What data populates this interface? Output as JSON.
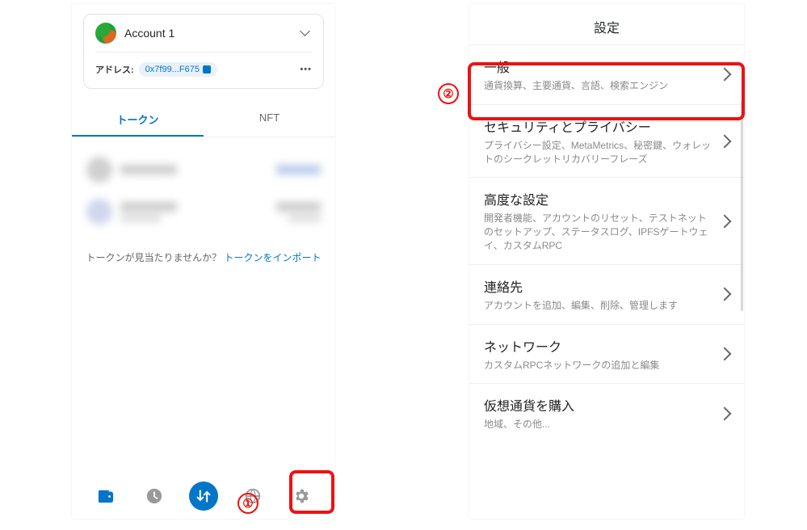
{
  "left": {
    "account_name": "Account 1",
    "address_label": "アドレス:",
    "address_short": "0x7f99...F675",
    "tabs": {
      "tokens": "トークン",
      "nft": "NFT"
    },
    "import_prompt": "トークンが見当たりませんか？ ",
    "import_link": "トークンをインポート"
  },
  "right": {
    "header": "設定",
    "items": [
      {
        "title": "一般",
        "desc": "通貨換算、主要通貨、言語、検索エンジン"
      },
      {
        "title": "セキュリティとプライバシー",
        "desc": "プライバシー設定、MetaMetrics、秘密鍵、ウォレットのシークレットリカバリーフレーズ"
      },
      {
        "title": "高度な設定",
        "desc": "開発者機能、アカウントのリセット、テストネットのセットアップ、ステータスログ、IPFSゲートウェイ、カスタムRPC"
      },
      {
        "title": "連絡先",
        "desc": "アカウントを追加、編集、削除、管理します"
      },
      {
        "title": "ネットワーク",
        "desc": "カスタムRPCネットワークの追加と編集"
      },
      {
        "title": "仮想通貨を購入",
        "desc": "地域、その他..."
      }
    ]
  },
  "annotations": {
    "one": "①",
    "two": "②"
  }
}
